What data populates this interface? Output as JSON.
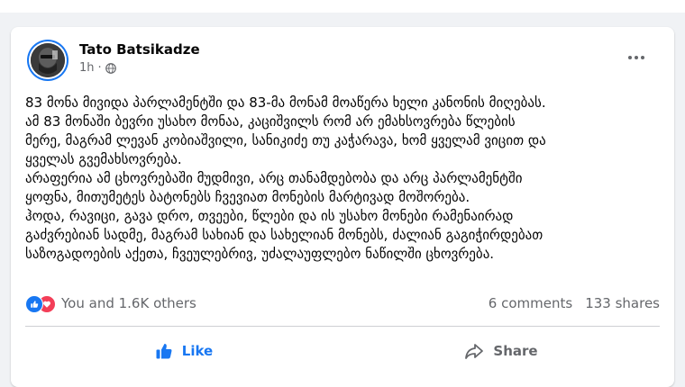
{
  "post": {
    "author": "Tato Batsikadze",
    "time": "1h",
    "privacy_sep": "·",
    "text_lines": [
      "83 მონა მივიდა პარლამენტში და 83-მა მონამ მოაწერა ხელი კანონის მიღებას.",
      "ამ 83 მონაში ბევრი უსახო მონაა, კაციშვილს რომ არ ემახსოვრება წლების",
      "მერე, მაგრამ ლევან კობიაშვილი, სანიკიძე თუ კაჭარავა, ხომ ყველამ ვიცით და",
      "ყველას გვემახსოვრება.",
      "არაფერია ამ ცხოვრებაში მუდმივი, არც თანამდებობა და არც პარლამენტში",
      "ყოფნა, მითუმეტეს ბატონებს ჩვევიათ მონების მარტივად მოშორება.",
      "ჰოდა, რავიცი, გავა დრო, თვეები, წლები და ის უსახო მონები რამენაირად",
      "გაძვრებიან სადმე, მაგრამ სახიან და სახელიან მონებს, ძალიან გაგიჭირდებათ",
      "საზოგადოების აქეთა, ჩვეულებრივ, უძალაუფლებო ნაწილში ცხოვრება."
    ]
  },
  "reactions": {
    "summary": "You and 1.6K others",
    "comments": "6 comments",
    "shares": "133 shares"
  },
  "actions": {
    "like": "Like",
    "share": "Share"
  },
  "colors": {
    "accent": "#1877f2",
    "love": "#f33e58",
    "muted": "#65676b"
  }
}
